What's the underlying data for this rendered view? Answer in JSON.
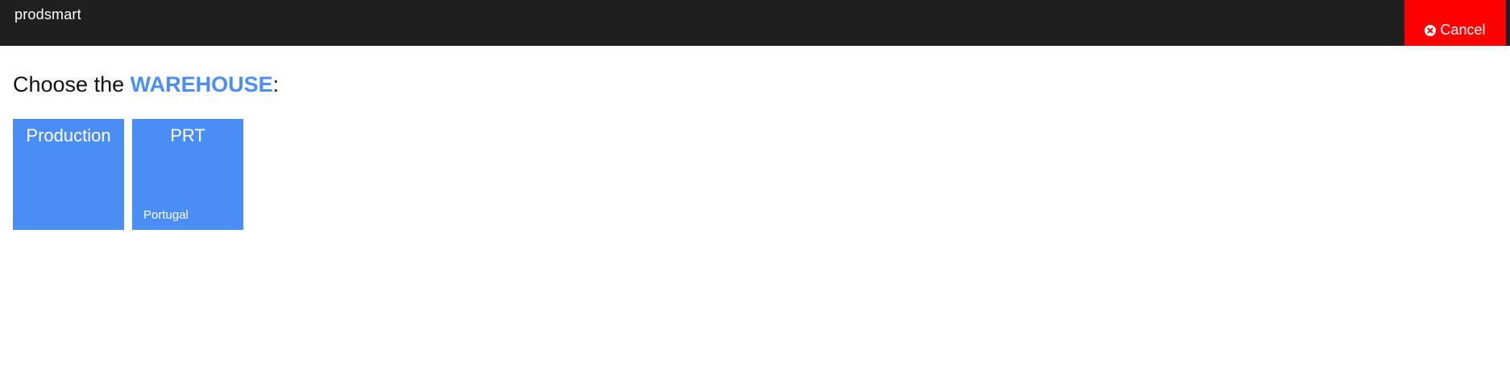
{
  "header": {
    "brand": "prodsmart",
    "cancel_label": "Cancel",
    "cancel_icon": "times-circle-icon",
    "background": "#1f1f1f",
    "cancel_color": "#ff0000"
  },
  "main": {
    "heading_prefix": "Choose the ",
    "heading_emphasis": "WAREHOUSE",
    "heading_suffix": ":",
    "accent": "#4a8ef5"
  },
  "warehouses": [
    {
      "name": "Production",
      "location": ""
    },
    {
      "name": "PRT",
      "location": "Portugal"
    }
  ]
}
